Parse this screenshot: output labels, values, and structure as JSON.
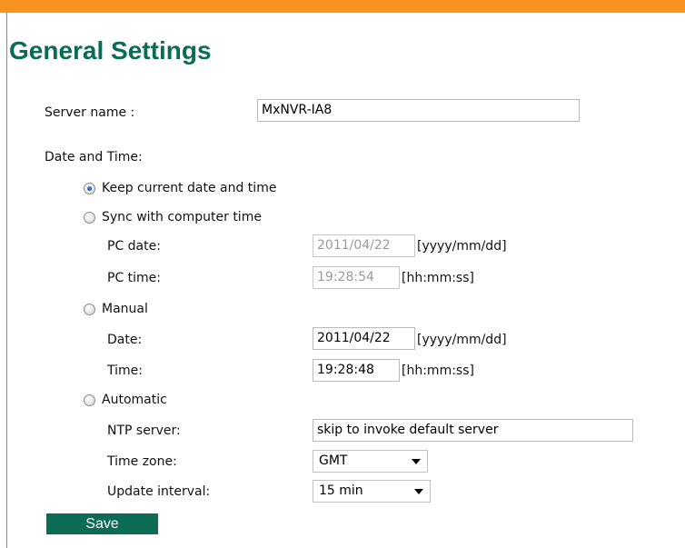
{
  "page": {
    "title": "General Settings"
  },
  "server": {
    "label": "Server name :",
    "value": "MxNVR-IA8"
  },
  "datetime": {
    "heading": "Date and Time:",
    "keep_current": {
      "label": "Keep current date and time",
      "checked": true
    },
    "sync": {
      "label": "Sync with computer time",
      "pc_date_label": "PC date:",
      "pc_date_value": "2011/04/22",
      "pc_date_format": "[yyyy/mm/dd]",
      "pc_time_label": "PC time:",
      "pc_time_value": "19:28:54",
      "pc_time_format": "[hh:mm:ss]"
    },
    "manual": {
      "label": "Manual",
      "date_label": "Date:",
      "date_value": "2011/04/22",
      "date_format": "[yyyy/mm/dd]",
      "time_label": "Time:",
      "time_value": "19:28:48",
      "time_format": "[hh:mm:ss]"
    },
    "automatic": {
      "label": "Automatic",
      "ntp_label": "NTP server:",
      "ntp_value": "skip to invoke default server",
      "tz_label": "Time zone:",
      "tz_value": "GMT",
      "interval_label": "Update interval:",
      "interval_value": "15 min"
    }
  },
  "actions": {
    "save_label": "Save"
  },
  "colors": {
    "accent_bar": "#f7931e",
    "brand_green": "#0b6b55"
  }
}
